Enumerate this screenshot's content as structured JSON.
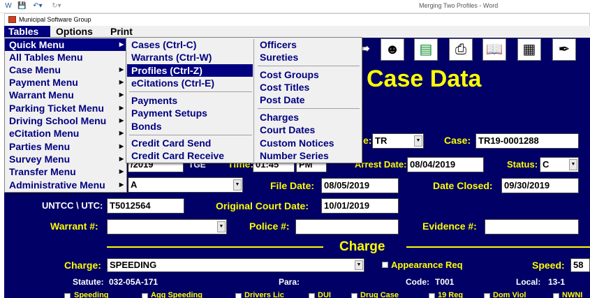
{
  "word": {
    "title": "Merging Two Profiles - Word"
  },
  "app": {
    "title": "Municipal Software Group"
  },
  "menubar": {
    "tables": "Tables",
    "options": "Options",
    "print": "Print"
  },
  "tables_menu": [
    "Quick Menu",
    "All Tables Menu",
    "Case Menu",
    "Payment Menu",
    "Warrant Menu",
    "Parking Ticket Menu",
    "Driving School Menu",
    "eCitation Menu",
    "Parties Menu",
    "Survey Menu",
    "Transfer Menu",
    "Administrative Menu"
  ],
  "quick_menu": [
    "Cases (Ctrl-C)",
    "Warrants (Ctrl-W)",
    "Profiles (Ctrl-Z)",
    "eCitations (Ctrl-E)",
    "Payments",
    "Payment Setups",
    "Bonds",
    "Credit Card Send",
    "Credit Card Receive"
  ],
  "quick_menu_col2": [
    "Officers",
    "Sureties",
    "Cost Groups",
    "Cost Titles",
    "Post Date",
    "Charges",
    "Court Dates",
    "Custom Notices",
    "Number Series"
  ],
  "toolbar_icons": [
    "document-icon",
    "people-network-icon",
    "table-icon",
    "printer-icon",
    "open-book-icon",
    "filing-cabinet-icon",
    "quill-pen-icon"
  ],
  "form": {
    "heading": "Case Data",
    "type_label_fragment": "e:",
    "type_value": "TR",
    "case_label": "Case:",
    "case_value": "TR19-0001288",
    "date_fragment": "/2019",
    "tz_fragment": "TGE",
    "time_label": "Time:",
    "time_value": "01:45",
    "ampm_value": "PM",
    "arrest_date_label": "Arrest Date:",
    "arrest_date_value": "08/04/2019",
    "status_label": "Status:",
    "status_value": "C",
    "row3_value": "A",
    "file_date_label": "File Date:",
    "file_date_value": "08/05/2019",
    "date_closed_label": "Date Closed:",
    "date_closed_value": "09/30/2019",
    "untcc_label": "UNTCC \\ UTC:",
    "untcc_value": "T5012564",
    "orig_court_label": "Original Court Date:",
    "orig_court_value": "10/01/2019",
    "warrant_label": "Warrant #:",
    "warrant_value": "",
    "police_label": "Police #:",
    "police_value": "",
    "evidence_label": "Evidence #:",
    "evidence_value": ""
  },
  "charge": {
    "section_title": "Charge",
    "charge_label": "Charge:",
    "charge_value": "SPEEDING",
    "appearance_req": "Appearance Req",
    "speed_label": "Speed:",
    "speed_value": "58",
    "statute_label": "Statute:",
    "statute_value": "032-05A-171",
    "para_label": "Para:",
    "code_label": "Code:",
    "code_value": "T001",
    "local_label": "Local:",
    "local_value": "13-1"
  },
  "checkboxes": [
    "Speeding",
    "Agg Speeding",
    "Drivers Lic",
    "DUI",
    "Drug Case",
    "19 Reg",
    "Dom Viol",
    "NWNI"
  ]
}
